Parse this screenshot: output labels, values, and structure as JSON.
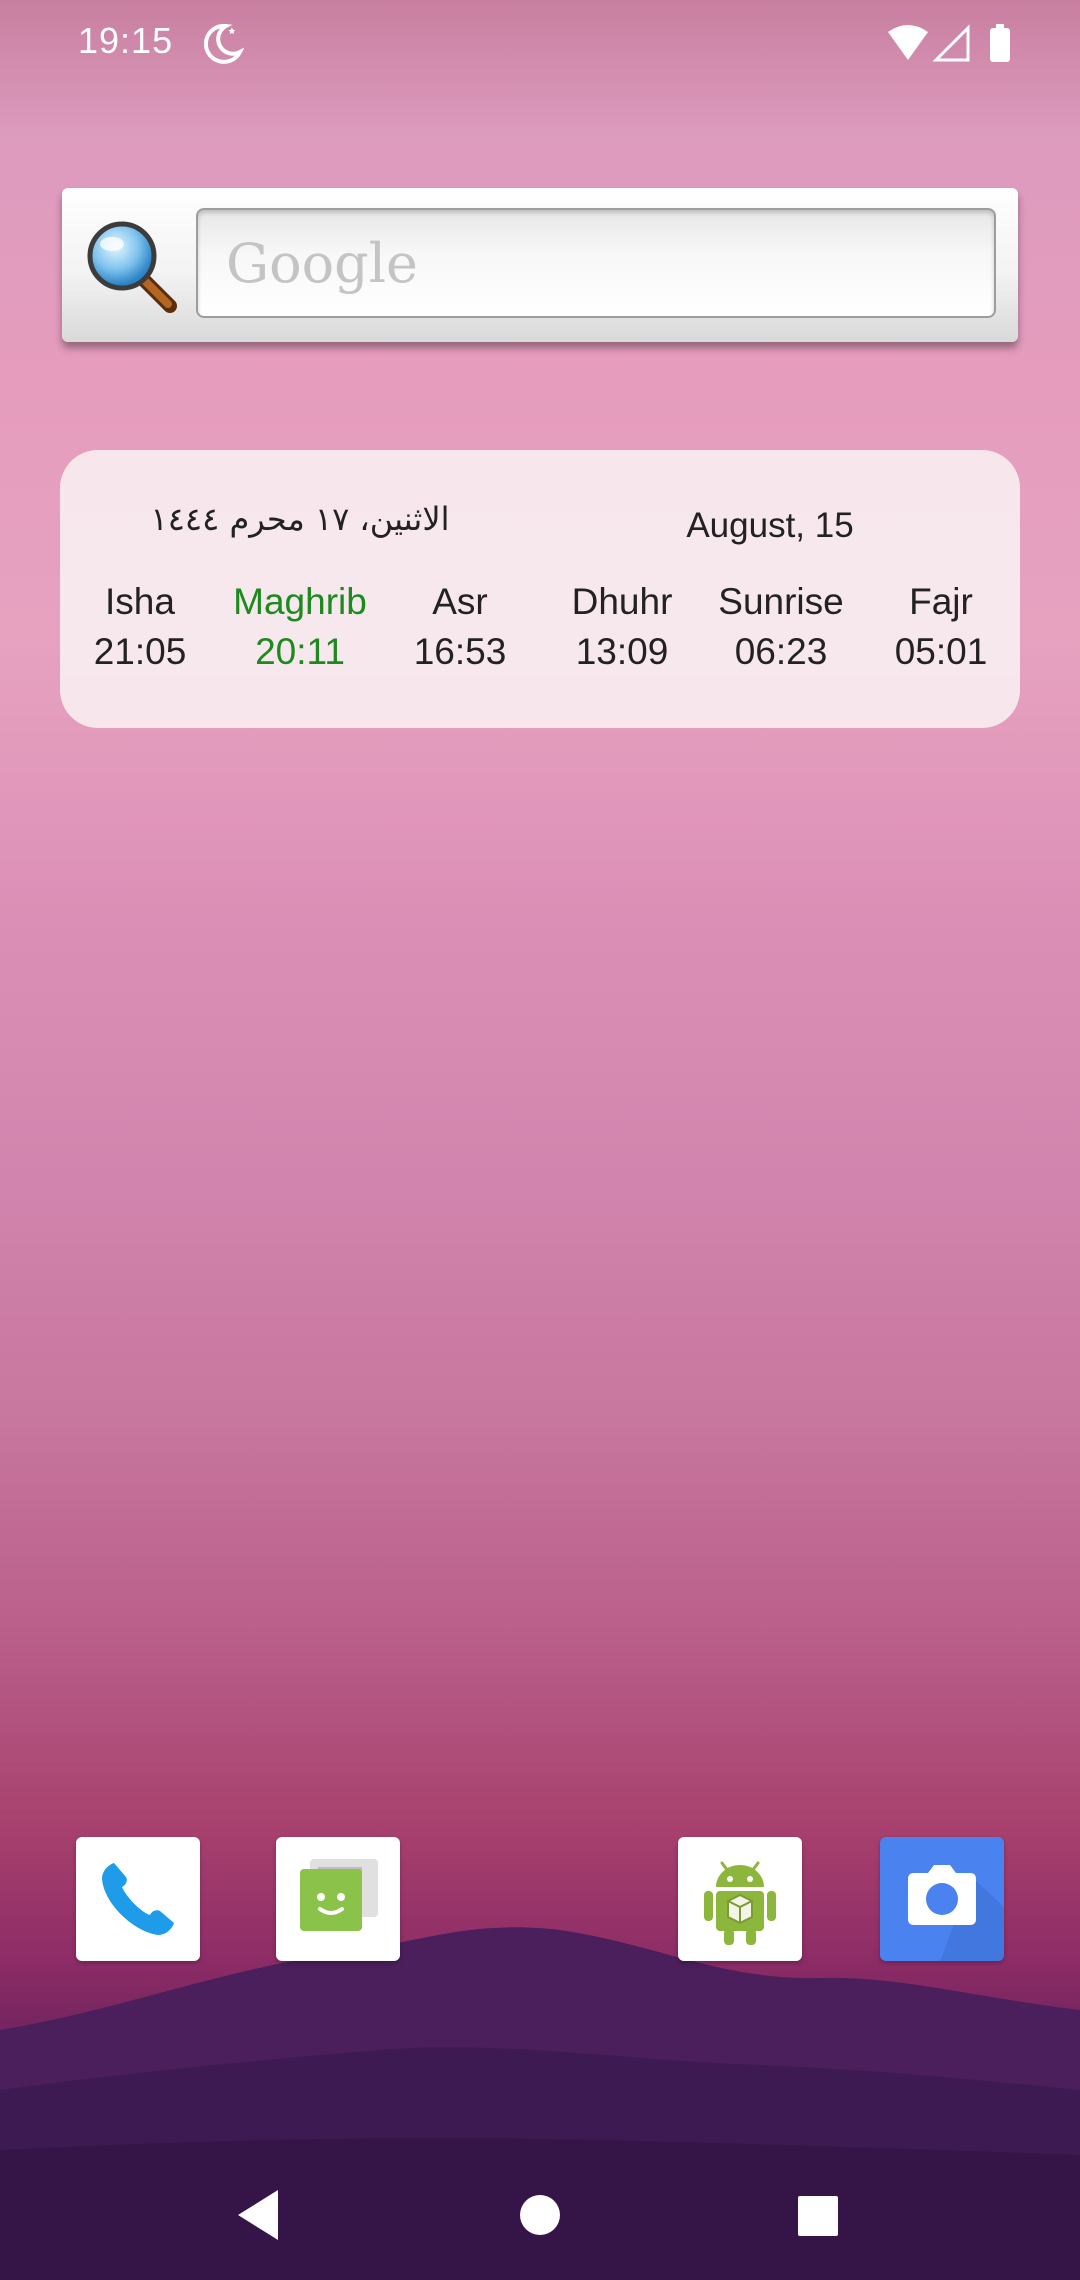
{
  "status_bar": {
    "time": "19:15",
    "left_icons": [
      "moon-icon"
    ],
    "right_icons": [
      "wifi-icon",
      "cellular-signal-icon",
      "battery-icon"
    ]
  },
  "search_widget": {
    "placeholder": "Google",
    "icon": "magnifier-icon"
  },
  "prayer_widget": {
    "hijri_date": "الاثنين، ١٧ محرم ١٤٤٤",
    "gregorian_date": "August, 15",
    "active_color": "#1c8a1c",
    "prayers": [
      {
        "name": "Isha",
        "time": "21:05"
      },
      {
        "name": "Maghrib",
        "time": "20:11",
        "active": true
      },
      {
        "name": "Asr",
        "time": "16:53"
      },
      {
        "name": "Dhuhr",
        "time": "13:09"
      },
      {
        "name": "Sunrise",
        "time": "06:23"
      },
      {
        "name": "Fajr",
        "time": "05:01"
      }
    ]
  },
  "dock": {
    "apps": [
      {
        "name": "Phone",
        "icon": "phone-icon"
      },
      {
        "name": "Messaging",
        "icon": "messaging-icon"
      },
      {
        "name": "Android app",
        "icon": "android-icon"
      },
      {
        "name": "Camera",
        "icon": "camera-icon"
      }
    ]
  },
  "nav_bar": {
    "buttons": [
      "back-icon",
      "home-icon",
      "recents-icon"
    ]
  }
}
